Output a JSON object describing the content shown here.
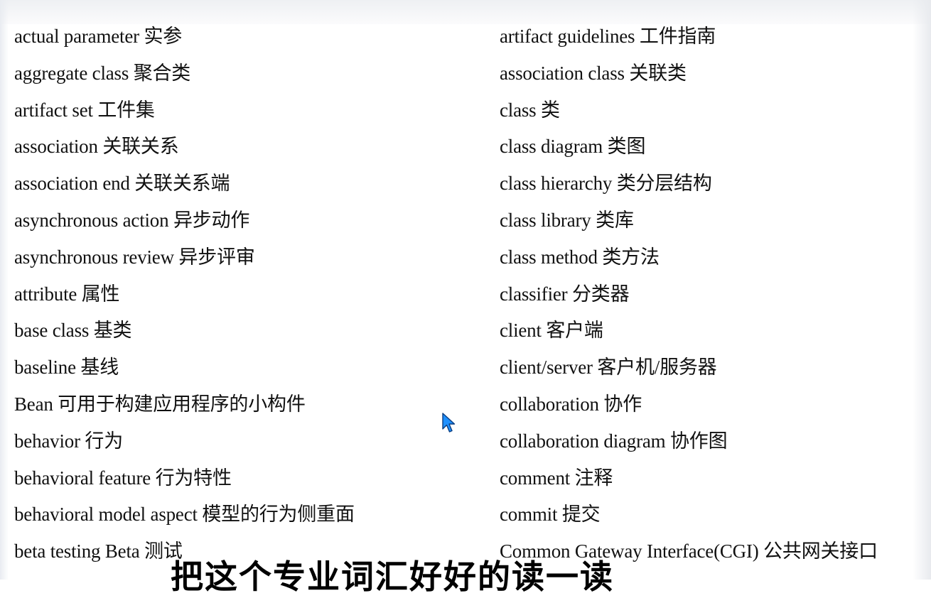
{
  "glossary": {
    "left": [
      "actual parameter 实参",
      "aggregate class 聚合类",
      "artifact set 工件集",
      "association 关联关系",
      "association end 关联关系端",
      "asynchronous action 异步动作",
      "asynchronous review 异步评审",
      "attribute 属性",
      "base class 基类",
      "baseline 基线",
      "Bean 可用于构建应用程序的小构件",
      "behavior 行为",
      "behavioral feature 行为特性",
      "behavioral model aspect 模型的行为侧重面",
      "beta testing Beta 测试"
    ],
    "right": [
      "artifact guidelines 工件指南",
      "association class 关联类",
      "class 类",
      "class diagram  类图",
      "class hierarchy  类分层结构",
      "class library  类库",
      "class method  类方法",
      "classifier  分类器",
      "client 客户端",
      "client/server  客户机/服务器",
      "collaboration  协作",
      "collaboration diagram 协作图",
      "comment 注释",
      "commit  提交",
      "Common Gateway Interface(CGI)  公共网关接口"
    ]
  },
  "subtitle": "把这个专业词汇好好的读一读",
  "icons": {
    "cursor": "mouse-pointer-icon"
  },
  "colors": {
    "text": "#111111",
    "cursor": "#1e90ff"
  }
}
